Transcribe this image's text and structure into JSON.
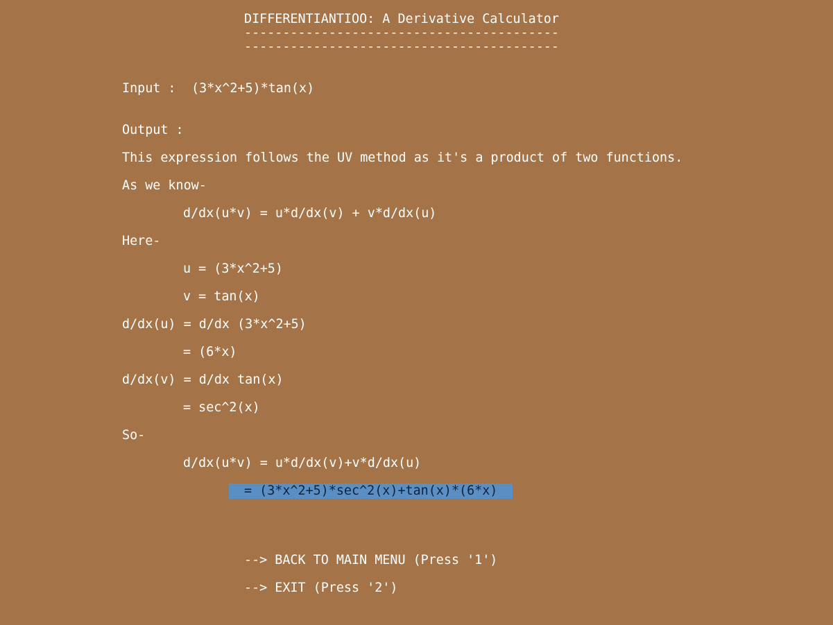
{
  "colors": {
    "background": "#a47448",
    "text": "#ffffff",
    "highlight_bg": "#5b8fc4",
    "highlight_text": "#10233a"
  },
  "header": {
    "title": "DIFFERENTIANTIOO: A Derivative Calculator",
    "rule1": "-----------------------------------------",
    "rule2": "-----------------------------------------"
  },
  "input": {
    "label": "Input :",
    "expression": "(3*x^2+5)*tan(x)"
  },
  "output": {
    "label": "Output :",
    "method_text": "This expression follows the UV method as it's a product of two functions.",
    "as_we_know": "As we know-",
    "rule": "d/dx(u*v) = u*d/dx(v) + v*d/dx(u)",
    "here": "Here-",
    "u_def": "u = (3*x^2+5)",
    "v_def": "v = tan(x)",
    "du_line": "d/dx(u) = d/dx (3*x^2+5)",
    "du_result": "= (6*x)",
    "dv_line": "d/dx(v) = d/dx tan(x)",
    "dv_result": "= sec^2(x)",
    "so": "So-",
    "final_rule": "d/dx(u*v) = u*d/dx(v)+v*d/dx(u)",
    "final_result": "= (3*x^2+5)*sec^2(x)+tan(x)*(6*x)"
  },
  "menu": {
    "back": "--> BACK TO MAIN MENU (Press '1')",
    "exit": "--> EXIT (Press '2')"
  }
}
